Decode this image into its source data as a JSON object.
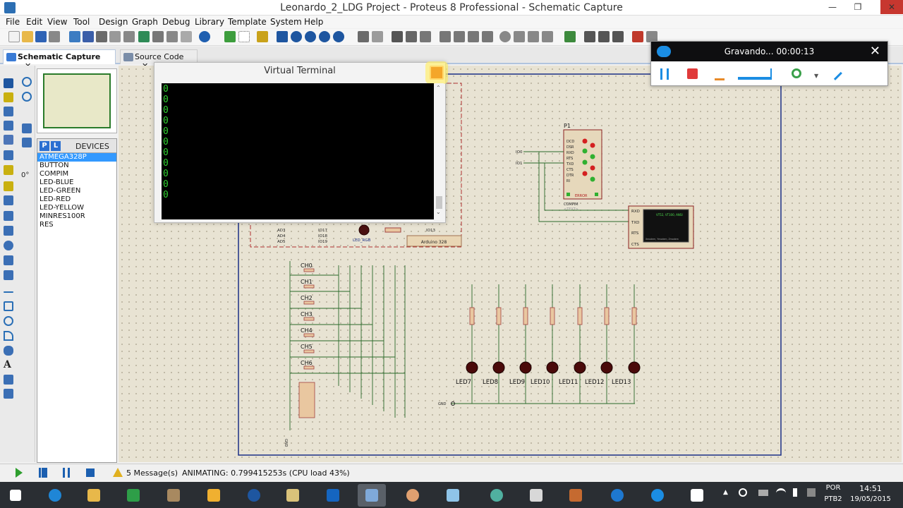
{
  "window": {
    "title": "Leonardo_2_LDG Project - Proteus 8 Professional - Schematic Capture"
  },
  "menu": [
    "File",
    "Edit",
    "View",
    "Tool",
    "Design",
    "Graph",
    "Debug",
    "Library",
    "Template",
    "System",
    "Help"
  ],
  "tabs": [
    {
      "label": "Schematic Capture"
    },
    {
      "label": "Source Code"
    }
  ],
  "devices": {
    "title": "DEVICES",
    "p_button": "P",
    "l_button": "L",
    "items": [
      "ATMEGA328P",
      "BUTTON",
      "COMPIM",
      "LED-BLUE",
      "LED-GREEN",
      "LED-RED",
      "LED-YELLOW",
      "MINRES100R",
      "RES"
    ],
    "selected": "ATMEGA328P"
  },
  "rotation": "0°",
  "virtual_terminal": {
    "title": "Virtual Terminal",
    "lines": [
      "0",
      "0",
      "0",
      "0",
      "0",
      "0",
      "0",
      "0",
      "0",
      "0",
      "0"
    ]
  },
  "recorder": {
    "status": "Gravando... 00:00:13"
  },
  "schematic": {
    "labels": {
      "p1": "P1",
      "compim": "COMPIM",
      "text_tag": "<TEXT>",
      "error": "ERROR",
      "gnd": "GND",
      "io0": "IO0",
      "io1": "IO1",
      "io13": "IO13",
      "led_rgb": "LED_RGB",
      "arduino": "Arduino 328",
      "rxd": "RXD",
      "txd": "TXD",
      "rts": "RTS",
      "cts": "CTS",
      "term_text": "VT52, VT100, ANSI",
      "xmodem": "Xmodem, Ymodem, Zmodem"
    },
    "com_pins": [
      "DCD",
      "DSR",
      "RXD",
      "RTS",
      "TXD",
      "CTS",
      "DTR",
      "RI"
    ],
    "adc_pins": [
      "AD3",
      "AD4",
      "AD5"
    ],
    "io_pins": [
      "IO17",
      "IO18",
      "IO19"
    ],
    "channels": [
      "CH0",
      "CH1",
      "CH2",
      "CH3",
      "CH4",
      "CH5",
      "CH6"
    ],
    "leds": [
      "LED7",
      "LED8",
      "LED9",
      "LED10",
      "LED11",
      "LED12",
      "LED13"
    ]
  },
  "status": {
    "messages": "5 Message(s)",
    "animating": "ANIMATING: 0.799415253s (CPU load 43%)"
  },
  "tray": {
    "lang1": "POR",
    "lang2": "PTB2",
    "time": "14:51",
    "date": "19/05/2015"
  }
}
